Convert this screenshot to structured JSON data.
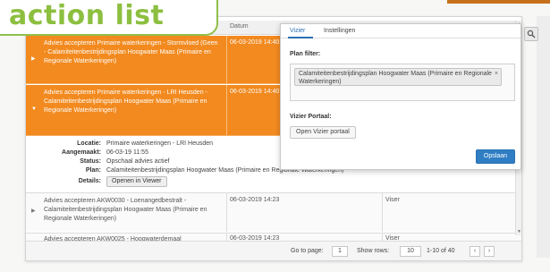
{
  "title": "action list",
  "table": {
    "headers": {
      "datum": "Datum"
    },
    "orange_rows": [
      {
        "description": "Advies accepteren Primaire waterkeringen - Stormvloed (Geen - Calamiteitenbestrijdingsplan Hoogwater Maas (Primaire en Regionale Waterkeringen)",
        "date": "06-03-2019 14:40"
      },
      {
        "description": "Advies accepteren Primaire waterkeringen - LRI Heusden - Calamiteitenbestrijdingsplan Hoogwater Maas (Primaire en Regionale Waterkeringen)",
        "date": "06-03-2019 14:40"
      }
    ],
    "details": {
      "locatie_label": "Locatie:",
      "locatie_value": "Primaire waterkeringen - LRI Heusden",
      "aangemaakt_label": "Aangemaakt:",
      "aangemaakt_value": "06-03-19 11:55",
      "status_label": "Status:",
      "status_value": "Opschaal advies actief",
      "plan_label": "Plan:",
      "plan_value": "Calamiteitenbestrijdingsplan Hoogwater Maas (Primaire en Regionale Waterkeringen)",
      "details_label": "Details:",
      "open_viewer_label": "Openen in Viewer"
    },
    "plain_rows": [
      {
        "description": "Advies accepteren AKW0030 - Loenangedbestralt - Calamiteitenbestrijdingsplan Hoogwater Maas (Primaire en Regionale Waterkeringen)",
        "date": "06-03-2019 14:23",
        "col3": "Viser"
      },
      {
        "description": "Advies accepteren AKW0025 - Hoogwaterdemaal",
        "date": "06-03-2019 14:23",
        "col3": "Viser"
      }
    ]
  },
  "pager": {
    "goto_label": "Go to page:",
    "page_value": "1",
    "show_rows_label": "Show rows:",
    "rows_value": "10",
    "range_text": "1-10 of 40",
    "prev": "‹",
    "next": "›"
  },
  "filter_popup": {
    "tabs": [
      "Vizier",
      "Instellingen"
    ],
    "plan_filter_label": "Plan filter:",
    "plan_chip": "Calamiteitenbestrijdingsplan Hoogwater Maas (Primaire en Regionale Waterkeringen)",
    "chip_close": "×",
    "portal_label": "Vizier Portaal:",
    "portal_button": "Open Vizier portaal",
    "apply_button": "Opslaan"
  },
  "icons": {
    "filter_toggle": "filter-icon",
    "row_expand": "chevron-right-icon"
  },
  "colors": {
    "accent_green": "#8cbf3f",
    "highlight_orange": "#f28a1f",
    "primary_blue": "#2f7ec4"
  }
}
